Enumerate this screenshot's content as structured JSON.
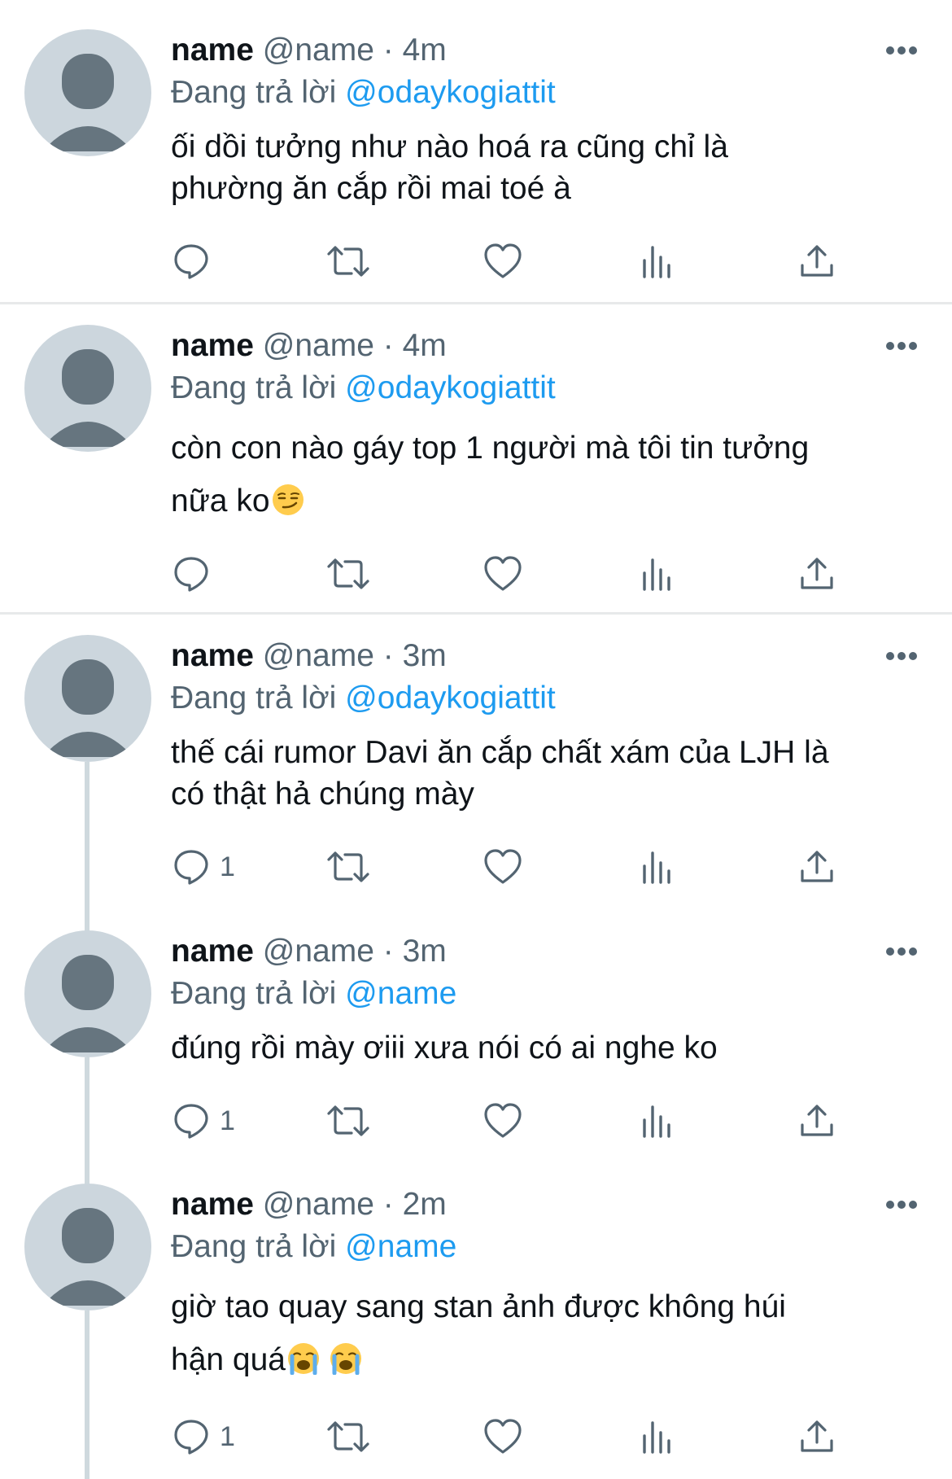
{
  "tweets": [
    {
      "name": "name",
      "handle": "@name",
      "dot": "·",
      "time": "4m",
      "replying_prefix": "Đang trả lời ",
      "replying_to": "@odaykogiattit",
      "lines": [
        "ối dồi tưởng như nào hoá ra cũng chỉ là",
        "phường ăn cắp rồi mai toé à"
      ],
      "reply_count": ""
    },
    {
      "name": "name",
      "handle": "@name",
      "dot": "·",
      "time": "4m",
      "replying_prefix": "Đang trả lời ",
      "replying_to": "@odaykogiattit",
      "lines": [
        "còn con nào gáy top 1 người mà tôi tin tưởng",
        "nữa ko"
      ],
      "emoji_names": [
        "smirking-face-emoji"
      ],
      "reply_count": ""
    },
    {
      "name": "name",
      "handle": "@name",
      "dot": "·",
      "time": "3m",
      "replying_prefix": "Đang trả lời ",
      "replying_to": "@odaykogiattit",
      "lines": [
        "thế cái rumor Davi ăn cắp chất xám của LJH là",
        "có thật hả chúng mày"
      ],
      "reply_count": "1"
    },
    {
      "name": "name",
      "handle": "@name",
      "dot": "·",
      "time": "3m",
      "replying_prefix": "Đang trả lời ",
      "replying_to": "@name",
      "lines": [
        "đúng rồi mày ơiii xưa nói có ai nghe ko"
      ],
      "reply_count": "1"
    },
    {
      "name": "name",
      "handle": "@name",
      "dot": "·",
      "time": "2m",
      "replying_prefix": "Đang trả lời ",
      "replying_to": "@name",
      "lines": [
        "giờ tao quay sang stan ảnh được không húi",
        "hận quá"
      ],
      "emoji_names": [
        "loudly-crying-face-emoji",
        "loudly-crying-face-emoji"
      ],
      "reply_count": "1"
    }
  ],
  "icons": {
    "reply": "reply-icon",
    "retweet": "retweet-icon",
    "like": "like-icon",
    "views": "views-icon",
    "share": "share-icon",
    "more": "more-icon"
  },
  "colors": {
    "mention": "#1d9bf0",
    "secondary_text": "#536471",
    "avatar_bg": "#ccd6dd",
    "avatar_figure": "#66757f",
    "thread_line": "#cfd9de",
    "divider": "#e7e9ea"
  }
}
